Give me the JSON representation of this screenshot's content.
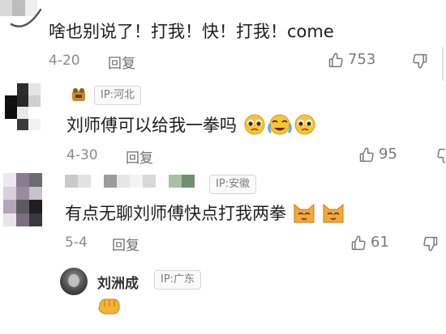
{
  "comments": [
    {
      "text": "啥也别说了！打我！快！打我！come",
      "date": "4-20",
      "reply_label": "回复",
      "likes": "753"
    },
    {
      "ip": "IP:河北",
      "text": "刘师傅可以给我一拳吗",
      "date": "4-30",
      "reply_label": "回复",
      "likes": "95"
    },
    {
      "ip": "IP:安徽",
      "text": "有点无聊刘师傅快点打我两拳",
      "date": "5-4",
      "reply_label": "回复",
      "likes": "61"
    },
    {
      "username": "刘洲成",
      "ip": "IP:广东"
    }
  ],
  "icons": {
    "like": "thumbs-up-icon",
    "dislike": "thumbs-down-icon",
    "emoji_pleading": "pleading-face-emoji",
    "emoji_crying": "crying-face-emoji",
    "emoji_cat": "cat-face-emoji",
    "emoji_fist": "fist-emoji"
  },
  "colors": {
    "text": "#1d1d1d",
    "meta": "#8a8a8a",
    "badge_border": "#d6d6d6"
  }
}
